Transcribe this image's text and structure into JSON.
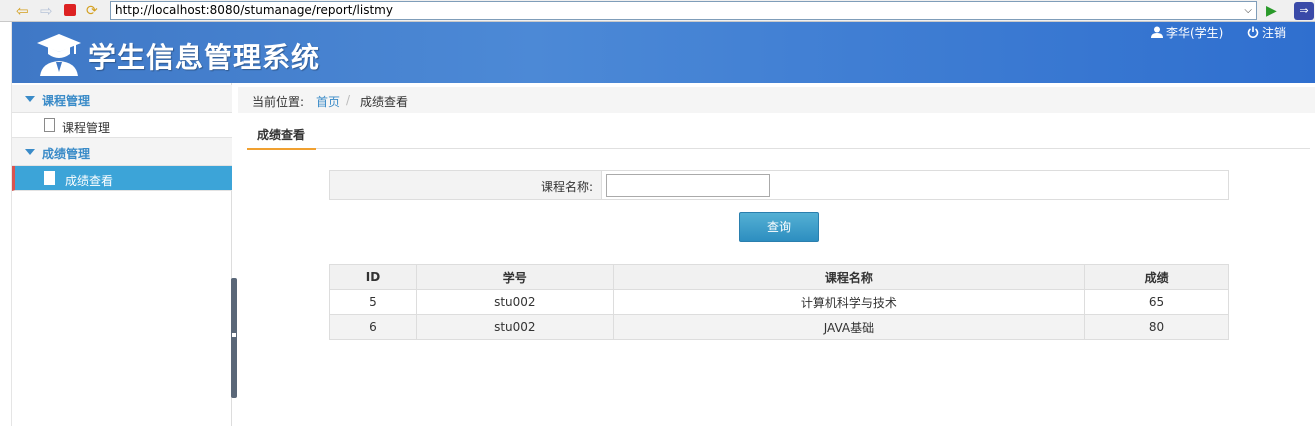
{
  "browser": {
    "url": "http://localhost:8080/stumanage/report/listmy"
  },
  "header": {
    "title": "学生信息管理系统",
    "user": "李华(学生)",
    "logout": "注销"
  },
  "sidebar": {
    "groups": [
      {
        "label": "课程管理",
        "items": [
          {
            "label": "课程管理"
          }
        ]
      },
      {
        "label": "成绩管理",
        "items": [
          {
            "label": "成绩查看"
          }
        ]
      }
    ]
  },
  "breadcrumb": {
    "label": "当前位置:",
    "home": "首页",
    "sep": "/",
    "current": "成绩查看"
  },
  "tab": {
    "label": "成绩查看"
  },
  "search": {
    "label": "课程名称:",
    "value": "",
    "button": "查询"
  },
  "table": {
    "headers": [
      "ID",
      "学号",
      "课程名称",
      "成绩"
    ],
    "rows": [
      [
        "5",
        "stu002",
        "计算机科学与技术",
        "65"
      ],
      [
        "6",
        "stu002",
        "JAVA基础",
        "80"
      ]
    ]
  }
}
